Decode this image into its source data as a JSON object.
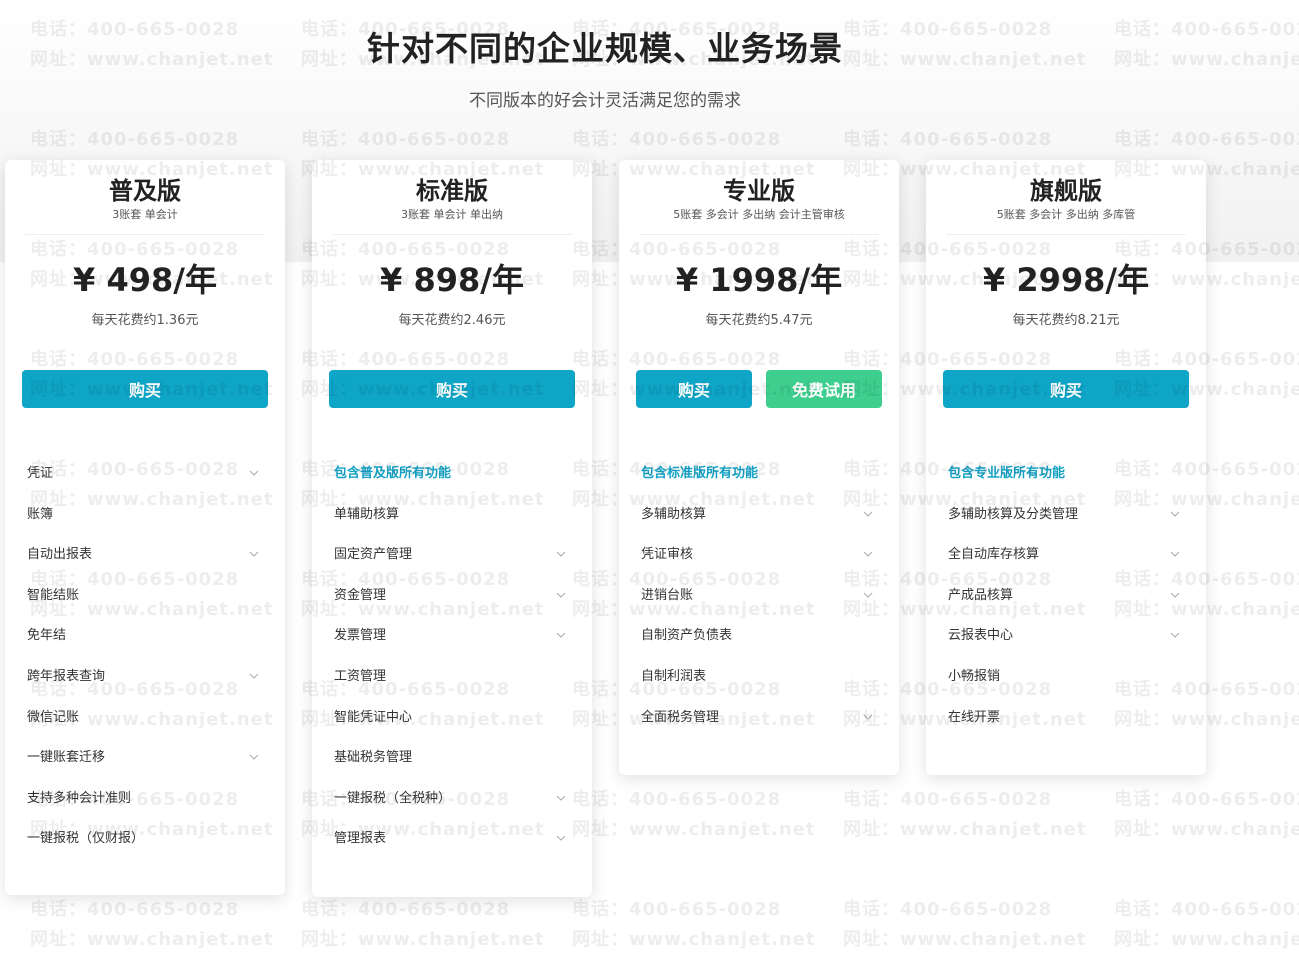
{
  "header": {
    "title": "针对不同的企业规模、业务场景",
    "subtitle": "不同版本的好会计灵活满足您的需求"
  },
  "watermark": {
    "phone": "电话：400-665-0028",
    "site": "网址：www.chanjet.net"
  },
  "colors": {
    "accent": "#0ea5c7",
    "trial": "#3ecf8e",
    "highlight": "#13a2c6"
  },
  "icons": {
    "expand": "chevron-down-icon"
  },
  "plans": [
    {
      "name": "普及版",
      "desc": "3账套 单会计",
      "price": "¥ 498/年",
      "daily": "每天花费约1.36元",
      "buttons": [
        {
          "label": "购买",
          "kind": "buy"
        }
      ],
      "features": [
        {
          "label": "凭证",
          "expand": true
        },
        {
          "label": "账簿",
          "expand": false
        },
        {
          "label": "自动出报表",
          "expand": true
        },
        {
          "label": "智能结账",
          "expand": false
        },
        {
          "label": "免年结",
          "expand": false
        },
        {
          "label": "跨年报表查询",
          "expand": true
        },
        {
          "label": "微信记账",
          "expand": false
        },
        {
          "label": "一键账套迁移",
          "expand": true
        },
        {
          "label": "支持多种会计准则",
          "expand": false
        },
        {
          "label": "一键报税（仅财报）",
          "expand": false
        }
      ]
    },
    {
      "name": "标准版",
      "desc": "3账套 单会计 单出纳",
      "price": "¥ 898/年",
      "daily": "每天花费约2.46元",
      "buttons": [
        {
          "label": "购买",
          "kind": "buy"
        }
      ],
      "features": [
        {
          "label": "包含普及版所有功能",
          "highlight": true
        },
        {
          "label": "单辅助核算",
          "expand": false
        },
        {
          "label": "固定资产管理",
          "expand": true
        },
        {
          "label": "资金管理",
          "expand": true
        },
        {
          "label": "发票管理",
          "expand": true
        },
        {
          "label": "工资管理",
          "expand": false
        },
        {
          "label": "智能凭证中心",
          "expand": false
        },
        {
          "label": "基础税务管理",
          "expand": false
        },
        {
          "label": "一键报税（全税种）",
          "expand": true
        },
        {
          "label": "管理报表",
          "expand": true
        }
      ]
    },
    {
      "name": "专业版",
      "desc": "5账套 多会计 多出纳 会计主管审核",
      "price": "¥ 1998/年",
      "daily": "每天花费约5.47元",
      "buttons": [
        {
          "label": "购买",
          "kind": "buy"
        },
        {
          "label": "免费试用",
          "kind": "trial"
        }
      ],
      "features": [
        {
          "label": "包含标准版所有功能",
          "highlight": true
        },
        {
          "label": "多辅助核算",
          "expand": true
        },
        {
          "label": "凭证审核",
          "expand": true
        },
        {
          "label": "进销台账",
          "expand": true
        },
        {
          "label": "自制资产负债表",
          "expand": false
        },
        {
          "label": "自制利润表",
          "expand": false
        },
        {
          "label": "全面税务管理",
          "expand": true
        }
      ]
    },
    {
      "name": "旗舰版",
      "desc": "5账套 多会计 多出纳 多库管",
      "price": "¥ 2998/年",
      "daily": "每天花费约8.21元",
      "buttons": [
        {
          "label": "购买",
          "kind": "buy"
        }
      ],
      "features": [
        {
          "label": "包含专业版所有功能",
          "highlight": true
        },
        {
          "label": "多辅助核算及分类管理",
          "expand": true
        },
        {
          "label": "全自动库存核算",
          "expand": true
        },
        {
          "label": "产成品核算",
          "expand": true
        },
        {
          "label": "云报表中心",
          "expand": true
        },
        {
          "label": "小畅报销",
          "expand": false
        },
        {
          "label": "在线开票",
          "expand": false
        }
      ]
    }
  ]
}
